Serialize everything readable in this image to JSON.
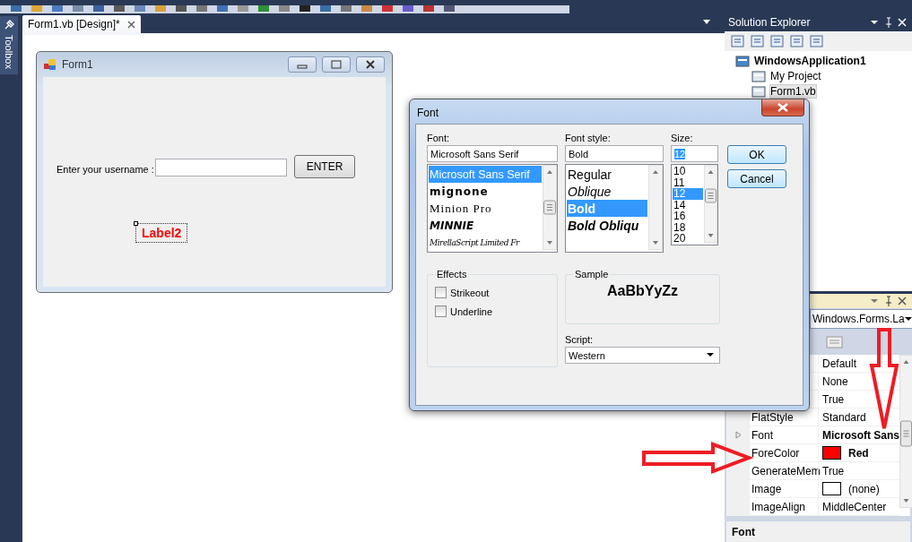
{
  "toolbox": {
    "label": "Toolbox"
  },
  "document_tabs": [
    {
      "label": "Form1.vb [Design]*",
      "selected": true
    }
  ],
  "form": {
    "title": "Form1",
    "controls": [
      {
        "kind": "label",
        "text": "Enter your username :",
        "selected": false,
        "color": "#000000",
        "bold": false
      },
      {
        "kind": "textbox",
        "selected": false
      },
      {
        "kind": "button",
        "text": "ENTER",
        "selected": false
      },
      {
        "kind": "label",
        "text": "Label2",
        "selected": true,
        "color": "#ff0000",
        "bold": true
      }
    ]
  },
  "font_dialog": {
    "title": "Font",
    "font_label": "Font:",
    "font_value": "Microsoft Sans Serif",
    "fonts": [
      {
        "name": "Microsoft Sans Serif",
        "selected": true
      },
      {
        "name": "mignone",
        "selected": false
      },
      {
        "name": "Minion Pro",
        "selected": false
      },
      {
        "name": "MINNIE",
        "selected": false
      },
      {
        "name": "MirellaScript Limited Fr",
        "selected": false
      }
    ],
    "style_label": "Font style:",
    "style_value": "Bold",
    "styles": [
      {
        "name": "Regular",
        "selected": false
      },
      {
        "name": "Oblique",
        "selected": false
      },
      {
        "name": "Bold",
        "selected": true
      },
      {
        "name": "Bold Obliqu",
        "selected": false
      }
    ],
    "size_label": "Size:",
    "size_value": "12",
    "sizes": [
      {
        "name": "10",
        "selected": false
      },
      {
        "name": "11",
        "selected": false
      },
      {
        "name": "12",
        "selected": true
      },
      {
        "name": "14",
        "selected": false
      },
      {
        "name": "16",
        "selected": false
      },
      {
        "name": "18",
        "selected": false
      },
      {
        "name": "20",
        "selected": false
      }
    ],
    "buttons": [
      "OK",
      "Cancel"
    ],
    "effects": {
      "title": "Effects",
      "options": [
        {
          "label": "Strikeout",
          "checked": false
        },
        {
          "label": "Underline",
          "checked": false
        }
      ]
    },
    "sample": {
      "title": "Sample",
      "text": "AaBbYyZz"
    },
    "script": {
      "label": "Script:",
      "value": "Western"
    }
  },
  "solution_explorer": {
    "title": "Solution Explorer",
    "tree": [
      {
        "label": "WindowsApplication1",
        "selected": false,
        "children": [
          {
            "label": "My Project",
            "selected": false
          },
          {
            "label": "Form1.vb",
            "selected": true
          }
        ]
      }
    ]
  },
  "properties": {
    "object": "Windows.Forms.La",
    "rows": [
      {
        "value": "Default",
        "modified": false
      },
      {
        "value": "None",
        "modified": false
      },
      {
        "value": "True",
        "modified": false
      },
      {
        "name": "FlatStyle",
        "value": "Standard",
        "modified": false
      },
      {
        "name": "Font",
        "value": "Microsoft Sans",
        "modified": true,
        "expandable": true
      },
      {
        "name": "ForeColor",
        "value": "Red",
        "modified": true,
        "color": "#ff0000"
      },
      {
        "name": "GenerateMem",
        "value": "True",
        "modified": false
      },
      {
        "name": "Image",
        "value": "(none)",
        "modified": false,
        "color": "#ffffff"
      },
      {
        "name": "ImageAlign",
        "value": "MiddleCenter",
        "modified": false
      }
    ],
    "description": "Font"
  },
  "annotations": [
    {
      "kind": "down"
    },
    {
      "kind": "right"
    }
  ]
}
